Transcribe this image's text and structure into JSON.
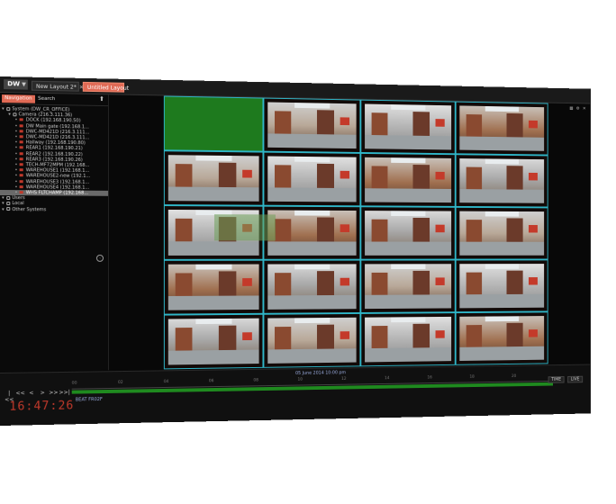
{
  "app": {
    "logo": "DW",
    "tabs": [
      {
        "label": "New Layout 2*",
        "active": false
      },
      {
        "label": "Untitled Layout",
        "active": true
      }
    ]
  },
  "sidebar": {
    "tabs": [
      "Navigation",
      "Search"
    ],
    "tree": [
      {
        "label": "System (DW_CR_OFFICE)",
        "type": "system",
        "depth": 0
      },
      {
        "label": "Camera (216.3.111.36)",
        "type": "system",
        "depth": 1
      },
      {
        "label": "DOCK (192.168.190.50)",
        "type": "camera",
        "depth": 2
      },
      {
        "label": "DW Main gate (192.168.1...",
        "type": "camera",
        "depth": 2
      },
      {
        "label": "DWC-MD421D (216.3.111...",
        "type": "camera",
        "depth": 2
      },
      {
        "label": "DWC-MD421D (216.3.111...",
        "type": "camera",
        "depth": 2
      },
      {
        "label": "Hallway (192.168.190.80)",
        "type": "camera",
        "depth": 2
      },
      {
        "label": "REAR1 (192.168.190.21)",
        "type": "camera",
        "depth": 2
      },
      {
        "label": "REAR2 (192.168.190.22)",
        "type": "camera",
        "depth": 2
      },
      {
        "label": "REAR3 (192.168.190.26)",
        "type": "camera",
        "depth": 2
      },
      {
        "label": "TECH-MF72MPM (192.168...",
        "type": "camera",
        "depth": 2
      },
      {
        "label": "WAREHOUSE1 (192.168.1...",
        "type": "camera",
        "depth": 2
      },
      {
        "label": "WAREHOUSE2-new (192.1...",
        "type": "camera",
        "depth": 2
      },
      {
        "label": "WAREHOUSE3 (192.168.1...",
        "type": "camera",
        "depth": 2
      },
      {
        "label": "WAREHOUSE4 (192.168.1...",
        "type": "camera",
        "depth": 2
      },
      {
        "label": "WHS FLTCHAMP (192.168...",
        "type": "camera",
        "depth": 2,
        "selected": true
      },
      {
        "label": "Users",
        "type": "system",
        "depth": 0
      },
      {
        "label": "Local",
        "type": "system",
        "depth": 0
      },
      {
        "label": "Other Systems",
        "type": "system",
        "depth": 0
      }
    ]
  },
  "timeline": {
    "date": "05 June 2014 10:00 pm",
    "clock": "16:47:26",
    "camera": "BEAT FR02F",
    "ticks": [
      "00",
      "02",
      "04",
      "06",
      "08",
      "10",
      "12",
      "14",
      "16",
      "18",
      "20"
    ],
    "controls": [
      "|<<",
      "<<",
      "<",
      ">",
      ">>",
      ">>|"
    ],
    "buttons": [
      "TIME",
      "LIVE"
    ]
  },
  "colors": {
    "accent": "#e06a55",
    "grid_border": "#2fb5c7",
    "timeline_track": "#1f8a1f",
    "clock": "#c0392b"
  }
}
